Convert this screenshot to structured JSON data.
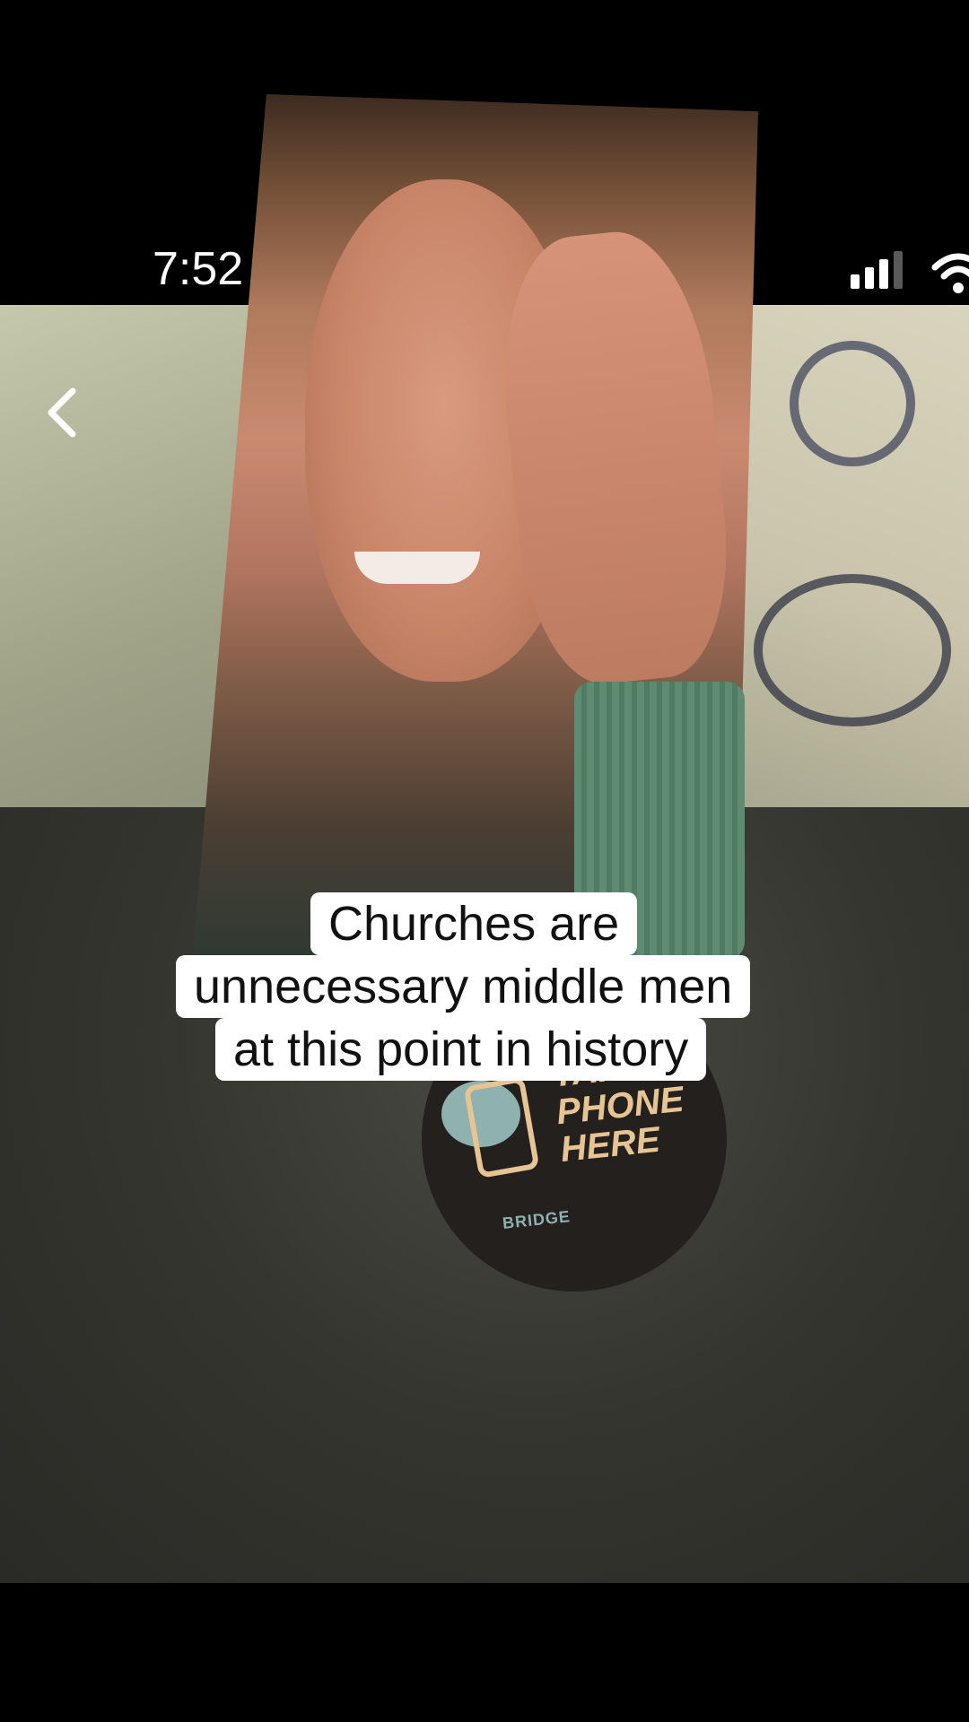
{
  "status_bar": {
    "time": "7:52"
  },
  "caption": {
    "line1": "Churches are",
    "line2": "unnecessary middle men",
    "line3": "at this point in history"
  },
  "patch": {
    "line1": "TAP",
    "line2": "PHONE",
    "line3": "HERE",
    "brand": "BRIDGE"
  },
  "icons": {
    "back": "chevron-left-icon",
    "signal": "cellular-signal-icon",
    "wifi": "wifi-icon"
  }
}
